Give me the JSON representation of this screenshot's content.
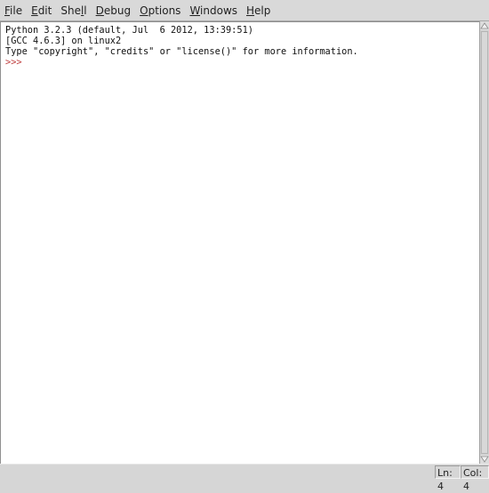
{
  "menubar": {
    "items": [
      {
        "label": "File",
        "mnemonic": "F",
        "rest": "ile"
      },
      {
        "label": "Edit",
        "mnemonic": "E",
        "rest": "dit"
      },
      {
        "label": "Shell",
        "pre": "She",
        "mnemonic": "l",
        "rest": "l"
      },
      {
        "label": "Debug",
        "mnemonic": "D",
        "rest": "ebug"
      },
      {
        "label": "Options",
        "mnemonic": "O",
        "rest": "ptions"
      },
      {
        "label": "Windows",
        "mnemonic": "W",
        "rest": "indows"
      },
      {
        "label": "Help",
        "mnemonic": "H",
        "rest": "elp"
      }
    ]
  },
  "shell": {
    "lines": [
      "Python 3.2.3 (default, Jul  6 2012, 13:39:51)",
      "[GCC 4.6.3] on linux2",
      "Type \"copyright\", \"credits\" or \"license()\" for more information."
    ],
    "prompt": ">>> "
  },
  "statusbar": {
    "line": "Ln: 4",
    "col": "Col: 4"
  },
  "colors": {
    "prompt": "#c04040",
    "background": "#ffffff",
    "chrome": "#d6d6d6"
  }
}
